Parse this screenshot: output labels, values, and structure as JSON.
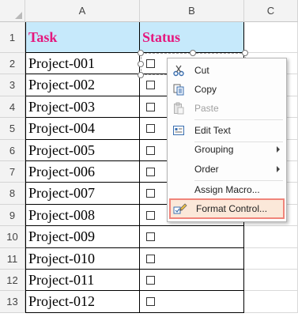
{
  "columns": [
    "A",
    "B",
    "C"
  ],
  "row_numbers": [
    "1",
    "2",
    "3",
    "4",
    "5",
    "6",
    "7",
    "8",
    "9",
    "10",
    "11",
    "12",
    "13"
  ],
  "header_row": {
    "task": "Task",
    "status": "Status"
  },
  "tasks": [
    "Project-001",
    "Project-002",
    "Project-003",
    "Project-004",
    "Project-005",
    "Project-006",
    "Project-007",
    "Project-008",
    "Project-009",
    "Project-010",
    "Project-011",
    "Project-012"
  ],
  "context_menu": {
    "cut": "Cut",
    "copy": "Copy",
    "paste": "Paste",
    "edit_text": "Edit Text",
    "grouping": "Grouping",
    "order": "Order",
    "assign_macro": "Assign Macro...",
    "format_control": "Format Control...",
    "highlighted_item": "Format Control..."
  },
  "colors": {
    "header_fill": "#c6e9fb",
    "header_text": "#e5177d",
    "highlight_border": "#f0847a"
  }
}
